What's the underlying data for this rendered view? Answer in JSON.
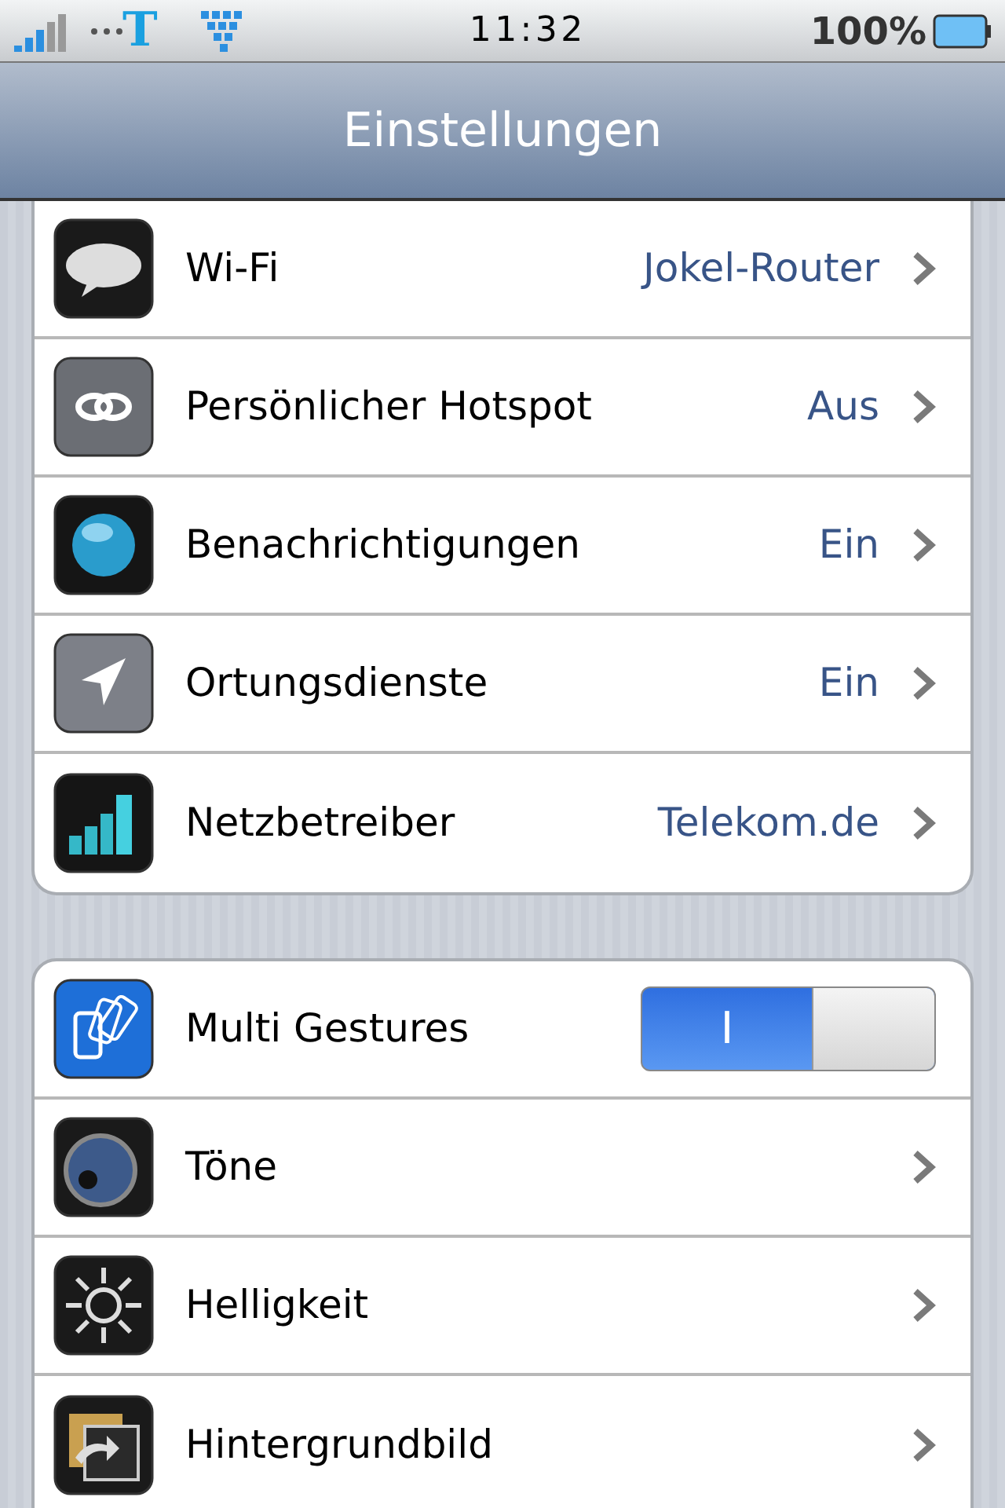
{
  "status_bar": {
    "carrier": "T",
    "time": "11:32",
    "battery": "100%"
  },
  "nav_bar": {
    "title": "Einstellungen"
  },
  "groups": [
    {
      "rows": [
        {
          "kind": "link",
          "label": "Wi-Fi",
          "value": "Jokel-Router"
        },
        {
          "kind": "link",
          "label": "Persönlicher Hotspot",
          "value": "Aus"
        },
        {
          "kind": "link",
          "label": "Benachrichtigungen",
          "value": "Ein"
        },
        {
          "kind": "link",
          "label": "Ortungsdienste",
          "value": "Ein"
        },
        {
          "kind": "link",
          "label": "Netzbetreiber",
          "value": "Telekom.de"
        }
      ]
    },
    {
      "rows": [
        {
          "kind": "switch",
          "label": "Multi Gestures",
          "on": true,
          "on_label": "I"
        },
        {
          "kind": "link",
          "label": "Töne"
        },
        {
          "kind": "link",
          "label": "Helligkeit"
        },
        {
          "kind": "link",
          "label": "Hintergrundbild"
        }
      ]
    }
  ]
}
